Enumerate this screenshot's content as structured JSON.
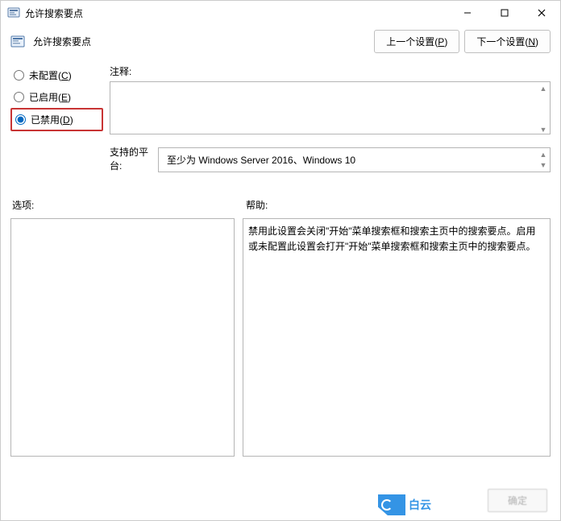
{
  "window": {
    "title": "允许搜索要点",
    "minimize": "—",
    "maximize": "□",
    "close": "✕"
  },
  "header": {
    "title": "允许搜索要点",
    "prev_label": "上一个设置",
    "prev_mnemonic": "P",
    "next_label": "下一个设置",
    "next_mnemonic": "N"
  },
  "radios": {
    "not_configured_label": "未配置",
    "not_configured_mnemonic": "C",
    "enabled_label": "已启用",
    "enabled_mnemonic": "E",
    "disabled_label": "已禁用",
    "disabled_mnemonic": "D",
    "selected": "disabled"
  },
  "fields": {
    "comment_label": "注释:",
    "comment_value": "",
    "platform_label": "支持的平台:",
    "platform_value": "至少为 Windows Server 2016、Windows 10"
  },
  "sections": {
    "options_label": "选项:",
    "help_label": "帮助:",
    "help_text": "禁用此设置会关闭\"开始\"菜单搜索框和搜索主页中的搜索要点。启用或未配置此设置会打开\"开始\"菜单搜索框和搜索主页中的搜索要点。"
  },
  "footer": {
    "ok_label": "确定",
    "watermark_text": "白云"
  }
}
